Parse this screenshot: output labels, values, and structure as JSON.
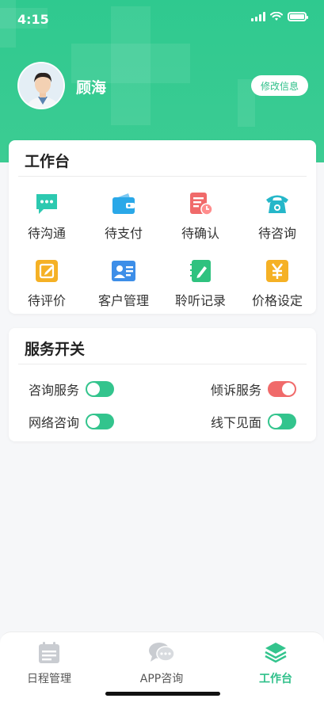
{
  "status_bar": {
    "time": "4:15"
  },
  "profile": {
    "name": "顾海",
    "edit_label": "修改信息"
  },
  "workbench": {
    "title": "工作台",
    "items": [
      {
        "label": "待沟通",
        "icon": "chat-icon",
        "color": "#2cc9b0"
      },
      {
        "label": "待支付",
        "icon": "wallet-icon",
        "color": "#2aa8e8"
      },
      {
        "label": "待确认",
        "icon": "document-clock-icon",
        "color": "#f06a6a"
      },
      {
        "label": "待咨询",
        "icon": "telephone-icon",
        "color": "#25b7c9"
      },
      {
        "label": "待评价",
        "icon": "edit-icon",
        "color": "#f5b125"
      },
      {
        "label": "客户管理",
        "icon": "contact-card-icon",
        "color": "#3d8ee8"
      },
      {
        "label": "聆听记录",
        "icon": "notebook-icon",
        "color": "#2fc27f"
      },
      {
        "label": "价格设定",
        "icon": "yen-icon",
        "color": "#f5b125"
      }
    ]
  },
  "services": {
    "title": "服务开关",
    "switches": [
      {
        "label": "咨询服务",
        "on": true,
        "color": "#33c48d"
      },
      {
        "label": "倾诉服务",
        "on": true,
        "color": "#f06a6a"
      },
      {
        "label": "网络咨询",
        "on": true,
        "color": "#33c48d"
      },
      {
        "label": "线下见面",
        "on": true,
        "color": "#33c48d"
      }
    ]
  },
  "tabbar": {
    "tabs": [
      {
        "label": "日程管理",
        "icon": "calendar-icon",
        "active": false
      },
      {
        "label": "APP咨询",
        "icon": "chat-bubbles-icon",
        "active": false
      },
      {
        "label": "工作台",
        "icon": "layers-icon",
        "active": true
      }
    ]
  },
  "colors": {
    "brand": "#33c48d",
    "accent_red": "#f06a6a"
  }
}
